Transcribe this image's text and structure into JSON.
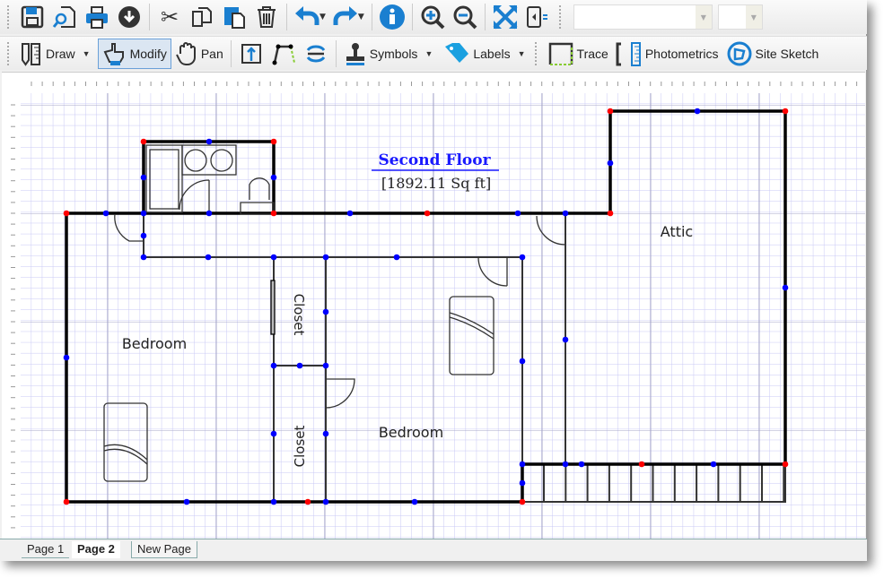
{
  "toolbar1": {
    "items": [
      {
        "icon": "save-icon"
      },
      {
        "icon": "print-preview-icon"
      },
      {
        "icon": "print-icon"
      },
      {
        "icon": "download-icon"
      },
      {
        "icon": "cut-icon"
      },
      {
        "icon": "copy-icon"
      },
      {
        "icon": "paste-icon"
      },
      {
        "icon": "delete-icon"
      },
      {
        "icon": "undo-icon"
      },
      {
        "icon": "redo-icon"
      },
      {
        "icon": "info-icon"
      },
      {
        "icon": "zoom-in-icon"
      },
      {
        "icon": "zoom-out-icon"
      },
      {
        "icon": "fit-icon"
      },
      {
        "icon": "panel-toggle-icon"
      }
    ],
    "combo1_value": "",
    "combo2_value": ""
  },
  "toolbar2": {
    "draw": "Draw",
    "modify": "Modify",
    "pan": "Pan",
    "symbols": "Symbols",
    "labels": "Labels",
    "trace": "Trace",
    "photometrics": "Photometrics",
    "site_sketch": "Site Sketch",
    "active_tool": "Modify"
  },
  "drawing": {
    "title": "Second Floor",
    "area": "[1892.11 Sq ft]",
    "rooms": {
      "bedroom_left": "Bedroom",
      "bedroom_center": "Bedroom",
      "closet_top": "Closet",
      "closet_bottom": "Closet",
      "attic": "Attic"
    },
    "colors": {
      "title": "#1a1aff",
      "grid": "#c8c8f5",
      "corner_node": "#ff0000",
      "mid_node": "#0000ff",
      "wall": "#000000"
    }
  },
  "tabs": {
    "items": [
      "Page 1",
      "Page 2",
      "New Page"
    ],
    "active": "Page 2"
  }
}
